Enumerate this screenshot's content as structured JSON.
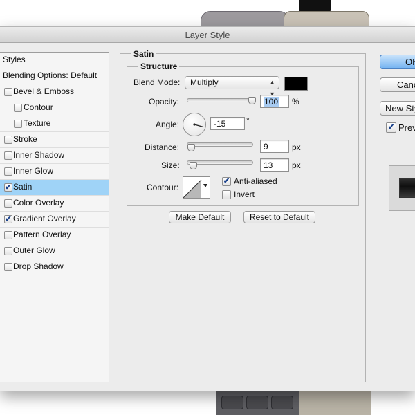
{
  "window": {
    "title": "Layer Style"
  },
  "styles_panel": {
    "header": "Styles",
    "blending_options": "Blending Options: Default",
    "items": [
      {
        "label": "Bevel & Emboss",
        "checked": false
      },
      {
        "label": "Contour",
        "checked": false
      },
      {
        "label": "Texture",
        "checked": false
      },
      {
        "label": "Stroke",
        "checked": false
      },
      {
        "label": "Inner Shadow",
        "checked": false
      },
      {
        "label": "Inner Glow",
        "checked": false
      },
      {
        "label": "Satin",
        "checked": true,
        "selected": true
      },
      {
        "label": "Color Overlay",
        "checked": false
      },
      {
        "label": "Gradient Overlay",
        "checked": true
      },
      {
        "label": "Pattern Overlay",
        "checked": false
      },
      {
        "label": "Outer Glow",
        "checked": false
      },
      {
        "label": "Drop Shadow",
        "checked": false
      }
    ]
  },
  "satin": {
    "group_title": "Satin",
    "structure_title": "Structure",
    "blend_mode_label": "Blend Mode:",
    "blend_mode_value": "Multiply",
    "blend_color": "#000000",
    "opacity_label": "Opacity:",
    "opacity_value": "100",
    "opacity_unit": "%",
    "angle_label": "Angle:",
    "angle_value": "-15",
    "angle_unit": "°",
    "distance_label": "Distance:",
    "distance_value": "9",
    "distance_unit": "px",
    "size_label": "Size:",
    "size_value": "13",
    "size_unit": "px",
    "contour_label": "Contour:",
    "anti_aliased_label": "Anti-aliased",
    "anti_aliased_checked": true,
    "invert_label": "Invert",
    "invert_checked": false
  },
  "buttons": {
    "make_default": "Make Default",
    "reset_to_default": "Reset to Default",
    "ok": "OK",
    "cancel": "Cancel",
    "new_style": "New Style...",
    "preview": "Preview"
  },
  "colors": {
    "selected_row": "#9fd3f7",
    "primary_button": "#74b3f1",
    "text_highlight": "#a7cbf2"
  }
}
